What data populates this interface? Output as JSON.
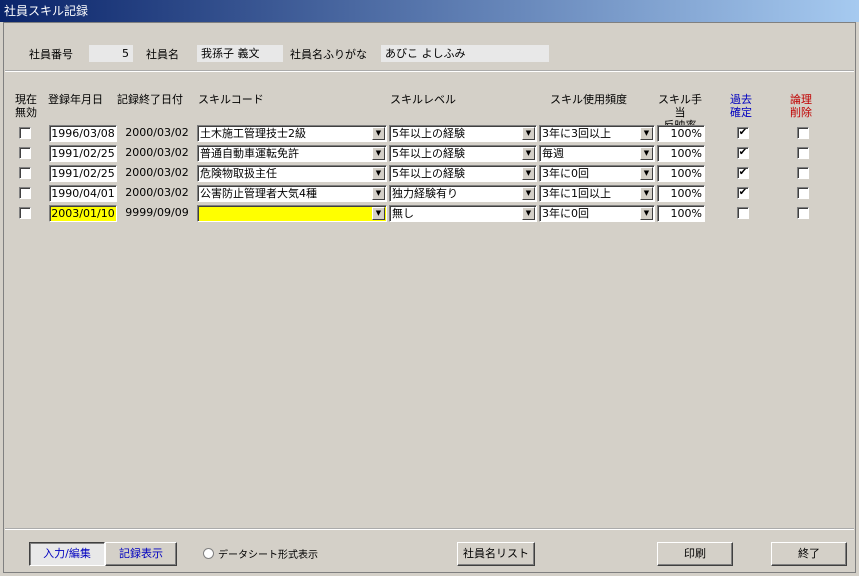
{
  "window": {
    "title": "社員スキル記録"
  },
  "header": {
    "emp_no_label": "社員番号",
    "emp_no": "5",
    "emp_name_label": "社員名",
    "emp_name": "我孫子 義文",
    "emp_kana_label": "社員名ふりがな",
    "emp_kana": "あびこ よしふみ"
  },
  "columns": {
    "invalid": [
      "現在",
      "無効"
    ],
    "reg_date": "登録年月日",
    "end_date": "記録終了日付",
    "skill_code": "スキルコード",
    "skill_level": "スキルレベル",
    "frequency": "スキル使用頻度",
    "allowance": [
      "スキル手当",
      "反映率"
    ],
    "past": [
      "過去",
      "確定"
    ],
    "logical": [
      "論理",
      "削除"
    ]
  },
  "rows": [
    {
      "invalid": false,
      "reg_date": "1996/03/08",
      "end_date": "2000/03/02",
      "skill_code": "土木施工管理技士2級",
      "skill_level": "5年以上の経験",
      "frequency": "3年に3回以上",
      "rate": "100%",
      "past": true,
      "deleted": false,
      "highlight": false
    },
    {
      "invalid": false,
      "reg_date": "1991/02/25",
      "end_date": "2000/03/02",
      "skill_code": "普通自動車運転免許",
      "skill_level": "5年以上の経験",
      "frequency": "毎週",
      "rate": "100%",
      "past": true,
      "deleted": false,
      "highlight": false
    },
    {
      "invalid": false,
      "reg_date": "1991/02/25",
      "end_date": "2000/03/02",
      "skill_code": "危険物取扱主任",
      "skill_level": "5年以上の経験",
      "frequency": "3年に0回",
      "rate": "100%",
      "past": true,
      "deleted": false,
      "highlight": false
    },
    {
      "invalid": false,
      "reg_date": "1990/04/01",
      "end_date": "2000/03/02",
      "skill_code": "公害防止管理者大気4種",
      "skill_level": "独力経験有り",
      "frequency": "3年に1回以上",
      "rate": "100%",
      "past": true,
      "deleted": false,
      "highlight": false
    },
    {
      "invalid": false,
      "reg_date": "2003/01/10",
      "end_date": "9999/09/09",
      "skill_code": "",
      "skill_level": "無し",
      "frequency": "3年に0回",
      "rate": "100%",
      "past": false,
      "deleted": false,
      "highlight": true
    }
  ],
  "footer": {
    "edit_tab": "入力/編集",
    "view_tab": "記録表示",
    "datasheet_label": "データシート形式表示",
    "name_list_button": "社員名リスト",
    "print_button": "印刷",
    "exit_button": "終了"
  },
  "colors": {
    "highlight": "#ffff00",
    "accent_blue": "#0000c0",
    "accent_red": "#c00000"
  }
}
